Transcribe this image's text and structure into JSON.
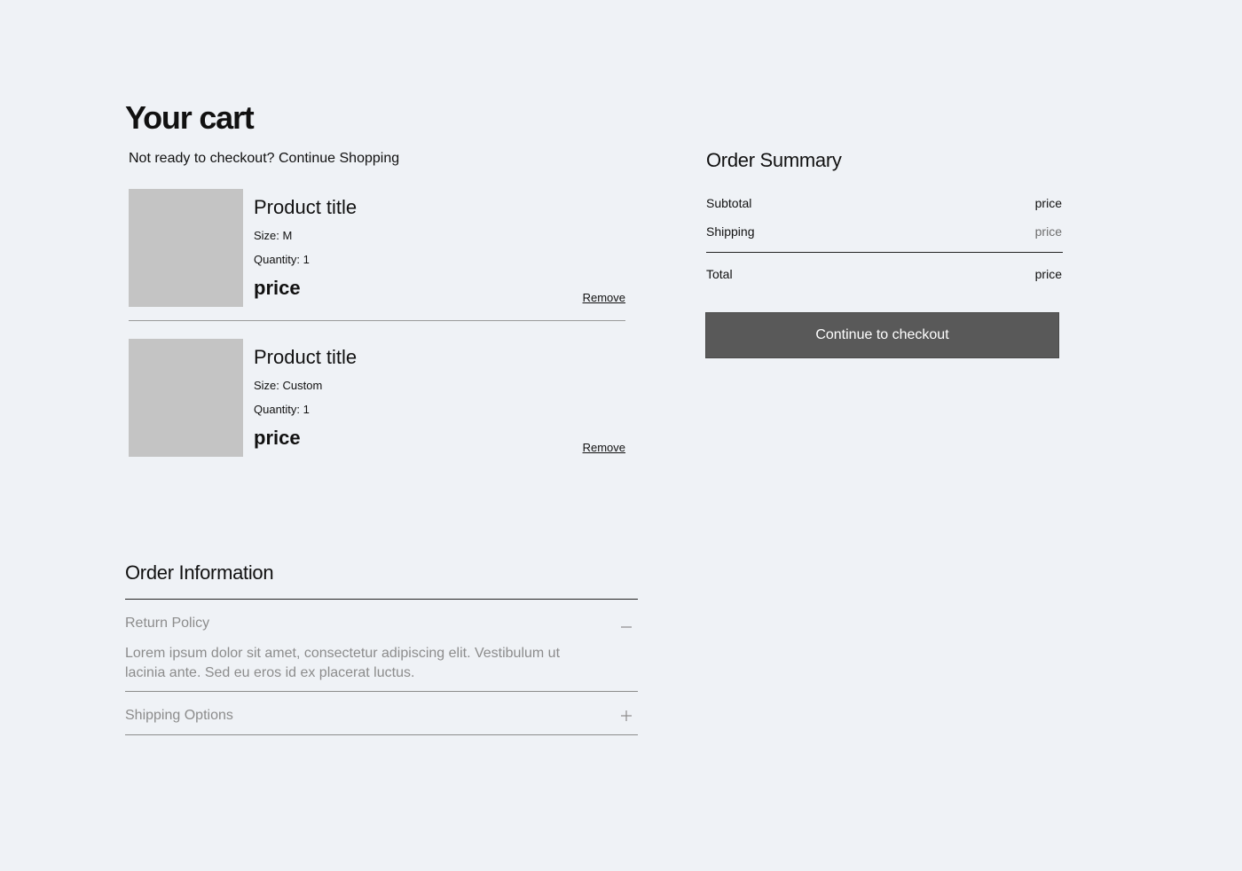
{
  "cart": {
    "title": "Your cart",
    "continue_prefix": "Not ready to checkout?",
    "continue_link": "Continue Shopping",
    "items": [
      {
        "title": "Product title",
        "size": "Size: M",
        "quantity": "Quantity: 1",
        "price": "price",
        "remove": "Remove"
      },
      {
        "title": "Product title",
        "size": "Size: Custom",
        "quantity": "Quantity: 1",
        "price": "price",
        "remove": "Remove"
      }
    ]
  },
  "summary": {
    "title": "Order Summary",
    "subtotal_label": "Subtotal",
    "subtotal_value": "price",
    "shipping_label": "Shipping",
    "shipping_value": "price",
    "total_label": "Total",
    "total_value": "price",
    "checkout_label": "Continue to checkout"
  },
  "order_info": {
    "title": "Order Information",
    "sections": [
      {
        "label": "Return Policy",
        "expanded": true,
        "toggle_icon": "minus-icon",
        "body": "Lorem ipsum dolor sit amet, consectetur adipiscing elit. Vestibulum ut lacinia ante. Sed eu eros id ex placerat luctus."
      },
      {
        "label": "Shipping Options",
        "expanded": false,
        "toggle_icon": "plus-icon"
      }
    ]
  },
  "colors": {
    "background": "#eff2f6",
    "thumbnail": "#c4c4c4",
    "checkout_button": "#595959",
    "muted_text": "#8c8c8c"
  }
}
